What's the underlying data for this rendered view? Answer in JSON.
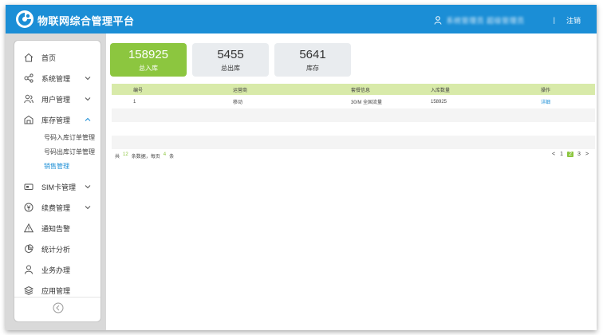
{
  "header": {
    "title": "物联网综合管理平台",
    "user": "系统管理员 超级管理员",
    "separator": "|",
    "logout": "注销"
  },
  "sidebar": {
    "items": [
      {
        "label": "首页",
        "icon": "home-icon"
      },
      {
        "label": "系统管理",
        "icon": "share-nodes-icon"
      },
      {
        "label": "用户管理",
        "icon": "users-icon"
      },
      {
        "label": "库存管理",
        "icon": "warehouse-icon"
      },
      {
        "label": "SIM卡管理",
        "icon": "sim-card-icon"
      },
      {
        "label": "续费管理",
        "icon": "yen-coin-icon"
      },
      {
        "label": "通知告警",
        "icon": "warning-icon"
      },
      {
        "label": "统计分析",
        "icon": "pie-chart-icon"
      },
      {
        "label": "业务办理",
        "icon": "person-icon"
      },
      {
        "label": "应用管理",
        "icon": "layers-icon"
      }
    ],
    "submenu": [
      {
        "label": "号码入库订单管理"
      },
      {
        "label": "号码出库订单管理"
      },
      {
        "label": "销售管理"
      }
    ]
  },
  "stats": [
    {
      "value": "158925",
      "label": "总入库"
    },
    {
      "value": "5455",
      "label": "总出库"
    },
    {
      "value": "5641",
      "label": "库存"
    }
  ],
  "table": {
    "headers": [
      "编号",
      "运营商",
      "套餐信息",
      "入库数量",
      "操作"
    ],
    "rows": [
      [
        "1",
        "移动",
        "30/M 全国流量",
        "158925",
        "详细"
      ]
    ]
  },
  "pagination": {
    "prefix": "共",
    "total": "12",
    "mid": "条数据，每页",
    "per_page": "4",
    "suffix": "条",
    "prev": "<",
    "pages": [
      "1",
      "2",
      "3"
    ],
    "next": ">"
  },
  "colors": {
    "brand_blue": "#1b8ed6",
    "accent_green": "#8cc63f",
    "table_header": "#d8eaa9"
  }
}
